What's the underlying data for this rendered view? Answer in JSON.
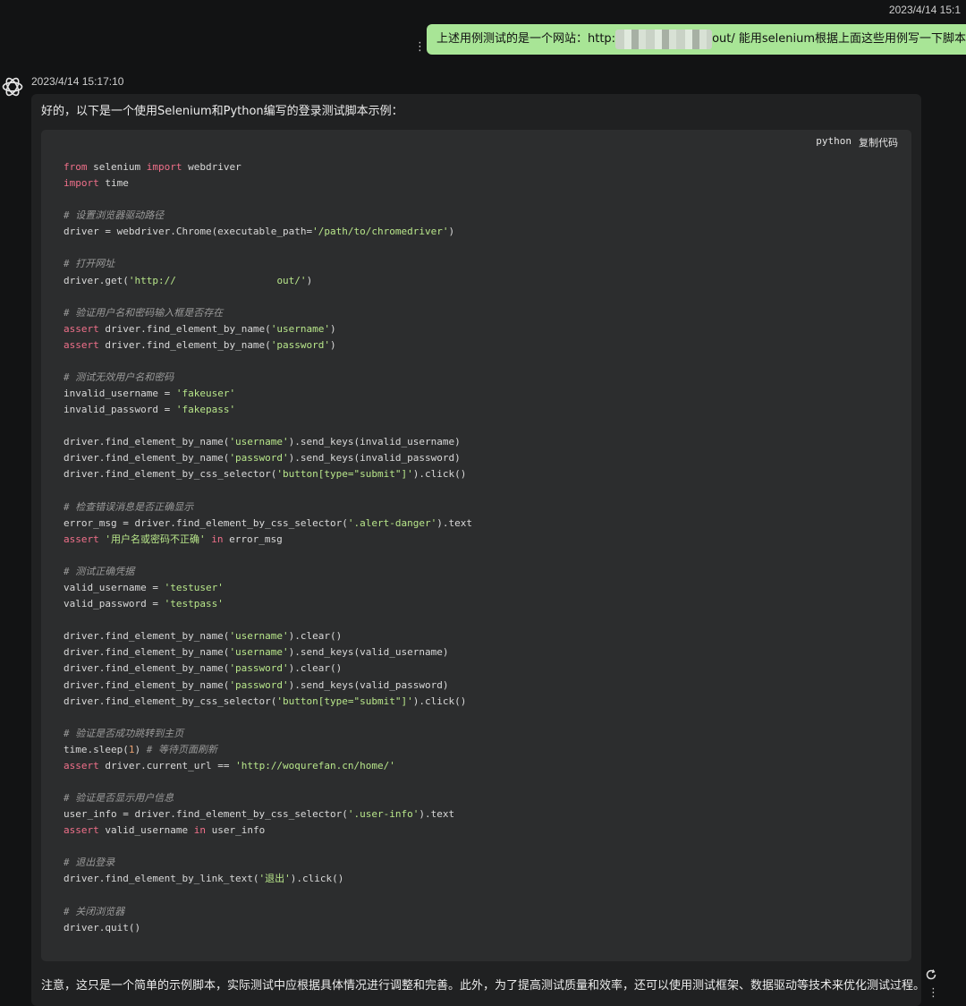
{
  "user_message": {
    "timestamp": "2023/4/14 15:1",
    "text_before": "上述用例测试的是一个网站：http:",
    "text_after": "out/  能用selenium根据上面这些用例写一下脚本吗",
    "more_icon": "vertical-dots-icon"
  },
  "assistant_message": {
    "avatar_icon": "openai-logo-icon",
    "timestamp": "2023/4/14 15:17:10",
    "intro": "好的，以下是一个使用Selenium和Python编写的登录测试脚本示例：",
    "code_block": {
      "language": "python",
      "copy_label": "复制代码",
      "lines": [
        [
          [
            "kw",
            "from"
          ],
          [
            "t",
            " selenium "
          ],
          [
            "kw",
            "import"
          ],
          [
            "t",
            " webdriver"
          ]
        ],
        [
          [
            "kw",
            "import"
          ],
          [
            "t",
            " time"
          ]
        ],
        [],
        [
          [
            "cm",
            "# 设置浏览器驱动路径"
          ]
        ],
        [
          [
            "t",
            "driver = webdriver.Chrome(executable_path="
          ],
          [
            "str",
            "'/path/to/chromedriver'"
          ],
          [
            "t",
            ")"
          ]
        ],
        [],
        [
          [
            "cm",
            "# 打开网址"
          ]
        ],
        [
          [
            "t",
            "driver.get("
          ],
          [
            "str",
            "'http://                 "
          ],
          [
            "str",
            "out/'"
          ],
          [
            "t",
            ")"
          ]
        ],
        [],
        [
          [
            "cm",
            "# 验证用户名和密码输入框是否存在"
          ]
        ],
        [
          [
            "kw",
            "assert"
          ],
          [
            "t",
            " driver.find_element_by_name("
          ],
          [
            "str",
            "'username'"
          ],
          [
            "t",
            ")"
          ]
        ],
        [
          [
            "kw",
            "assert"
          ],
          [
            "t",
            " driver.find_element_by_name("
          ],
          [
            "str",
            "'password'"
          ],
          [
            "t",
            ")"
          ]
        ],
        [],
        [
          [
            "cm",
            "# 测试无效用户名和密码"
          ]
        ],
        [
          [
            "t",
            "invalid_username = "
          ],
          [
            "str",
            "'fakeuser'"
          ]
        ],
        [
          [
            "t",
            "invalid_password = "
          ],
          [
            "str",
            "'fakepass'"
          ]
        ],
        [],
        [
          [
            "t",
            "driver.find_element_by_name("
          ],
          [
            "str",
            "'username'"
          ],
          [
            "t",
            ").send_keys(invalid_username)"
          ]
        ],
        [
          [
            "t",
            "driver.find_element_by_name("
          ],
          [
            "str",
            "'password'"
          ],
          [
            "t",
            ").send_keys(invalid_password)"
          ]
        ],
        [
          [
            "t",
            "driver.find_element_by_css_selector("
          ],
          [
            "str",
            "'button[type=\"submit\"]'"
          ],
          [
            "t",
            ").click()"
          ]
        ],
        [],
        [
          [
            "cm",
            "# 检查错误消息是否正确显示"
          ]
        ],
        [
          [
            "t",
            "error_msg = driver.find_element_by_css_selector("
          ],
          [
            "str",
            "'.alert-danger'"
          ],
          [
            "t",
            ").text"
          ]
        ],
        [
          [
            "kw",
            "assert"
          ],
          [
            "t",
            " "
          ],
          [
            "str",
            "'用户名或密码不正确'"
          ],
          [
            "t",
            " "
          ],
          [
            "kw",
            "in"
          ],
          [
            "t",
            " error_msg"
          ]
        ],
        [],
        [
          [
            "cm",
            "# 测试正确凭据"
          ]
        ],
        [
          [
            "t",
            "valid_username = "
          ],
          [
            "str",
            "'testuser'"
          ]
        ],
        [
          [
            "t",
            "valid_password = "
          ],
          [
            "str",
            "'testpass'"
          ]
        ],
        [],
        [
          [
            "t",
            "driver.find_element_by_name("
          ],
          [
            "str",
            "'username'"
          ],
          [
            "t",
            ").clear()"
          ]
        ],
        [
          [
            "t",
            "driver.find_element_by_name("
          ],
          [
            "str",
            "'username'"
          ],
          [
            "t",
            ").send_keys(valid_username)"
          ]
        ],
        [
          [
            "t",
            "driver.find_element_by_name("
          ],
          [
            "str",
            "'password'"
          ],
          [
            "t",
            ").clear()"
          ]
        ],
        [
          [
            "t",
            "driver.find_element_by_name("
          ],
          [
            "str",
            "'password'"
          ],
          [
            "t",
            ").send_keys(valid_password)"
          ]
        ],
        [
          [
            "t",
            "driver.find_element_by_css_selector("
          ],
          [
            "str",
            "'button[type=\"submit\"]'"
          ],
          [
            "t",
            ").click()"
          ]
        ],
        [],
        [
          [
            "cm",
            "# 验证是否成功跳转到主页"
          ]
        ],
        [
          [
            "t",
            "time.sleep("
          ],
          [
            "num",
            "1"
          ],
          [
            "t",
            ") "
          ],
          [
            "cm",
            "# 等待页面刷新"
          ]
        ],
        [
          [
            "kw",
            "assert"
          ],
          [
            "t",
            " driver.current_url == "
          ],
          [
            "str",
            "'http://woqurefan.cn/home/'"
          ]
        ],
        [],
        [
          [
            "cm",
            "# 验证是否显示用户信息"
          ]
        ],
        [
          [
            "t",
            "user_info = driver.find_element_by_css_selector("
          ],
          [
            "str",
            "'.user-info'"
          ],
          [
            "t",
            ").text"
          ]
        ],
        [
          [
            "kw",
            "assert"
          ],
          [
            "t",
            " valid_username "
          ],
          [
            "kw",
            "in"
          ],
          [
            "t",
            " user_info"
          ]
        ],
        [],
        [
          [
            "cm",
            "# 退出登录"
          ]
        ],
        [
          [
            "t",
            "driver.find_element_by_link_text("
          ],
          [
            "str",
            "'退出'"
          ],
          [
            "t",
            ").click()"
          ]
        ],
        [],
        [
          [
            "cm",
            "# 关闭浏览器"
          ]
        ],
        [
          [
            "t",
            "driver.quit()"
          ]
        ]
      ]
    },
    "outro": "注意，这只是一个简单的示例脚本，实际测试中应根据具体情况进行调整和完善。此外，为了提高测试质量和效率，还可以使用测试框架、数据驱动等技术来优化测试过程。",
    "refresh_icon": "refresh-icon",
    "more_icon": "vertical-dots-icon"
  }
}
